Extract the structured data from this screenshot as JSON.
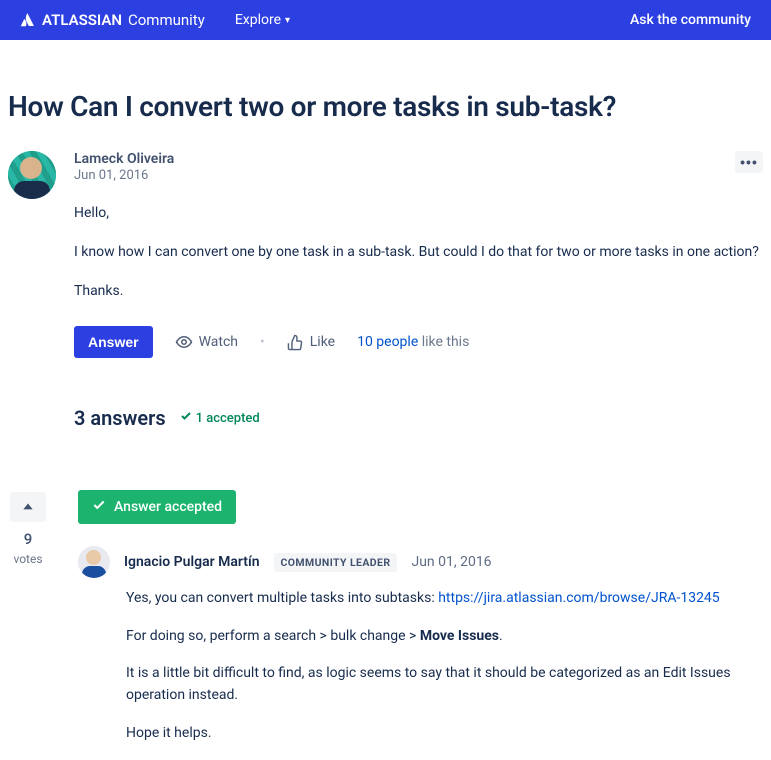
{
  "topbar": {
    "brand_name": "ATLASSIAN",
    "brand_suffix": "Community",
    "explore": "Explore",
    "ask": "Ask the community"
  },
  "question": {
    "title": "How Can I convert two or more tasks in sub-task?",
    "author": "Lameck Oliveira",
    "date": "Jun 01, 2016",
    "body": {
      "p1": "Hello,",
      "p2": "I know how I can convert one by one task in a sub-task. But could I do that for two or more tasks in one action?",
      "p3": "Thanks."
    }
  },
  "actions": {
    "answer": "Answer",
    "watch": "Watch",
    "like": "Like",
    "like_count": "10 people",
    "like_suffix": " like this"
  },
  "answers_header": {
    "count": "3 answers",
    "accepted": "1 accepted"
  },
  "answer1": {
    "votes": "9",
    "votes_label": "votes",
    "accepted_badge": "Answer accepted",
    "author": "Ignacio Pulgar Martín",
    "badge": "COMMUNITY LEADER",
    "date": "Jun 01, 2016",
    "content": {
      "p1_a": "Yes, you can convert multiple tasks into subtasks: ",
      "p1_link": "https://jira.atlassian.com/browse/JRA-13245",
      "p2_a": "For doing so, perform a search > bulk change > ",
      "p2_bold": "Move Issues",
      "p2_b": ".",
      "p3": "It is a little bit difficult to find, as logic seems to say that it should be categorized as an Edit Issues operation instead.",
      "p4": "Hope it helps."
    }
  }
}
